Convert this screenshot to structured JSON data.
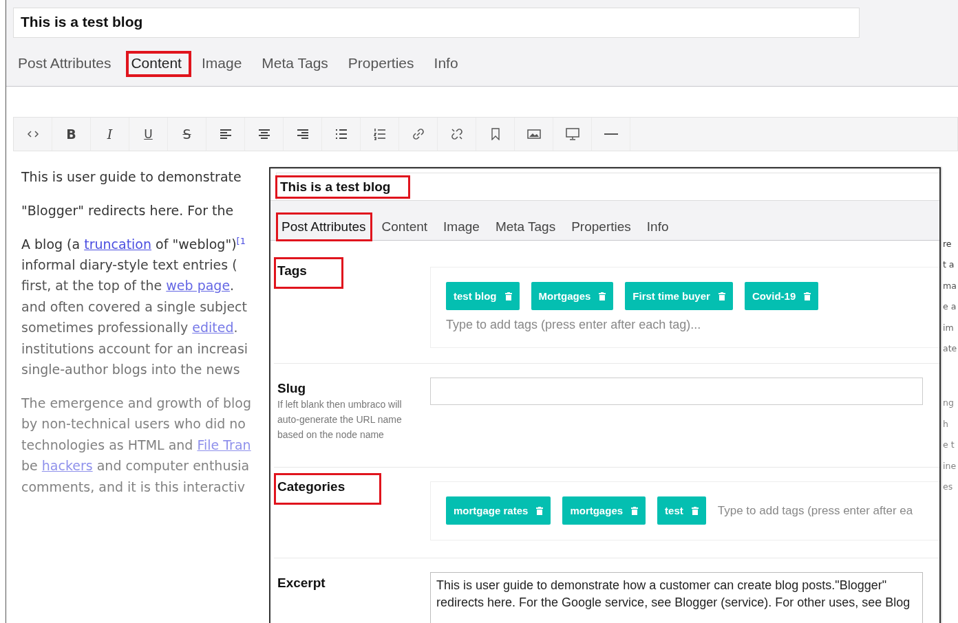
{
  "back_window": {
    "title": {
      "value": "This is a test blog",
      "highlighted": false
    },
    "tabs": [
      {
        "label": "Post Attributes",
        "highlighted": false
      },
      {
        "label": "Content",
        "highlighted": true
      },
      {
        "label": "Image",
        "highlighted": false
      },
      {
        "label": "Meta Tags",
        "highlighted": false
      },
      {
        "label": "Properties",
        "highlighted": false
      },
      {
        "label": "Info",
        "highlighted": false
      }
    ],
    "toolbar_letters": [
      "B",
      "I",
      "U",
      "S"
    ],
    "paragraphs": [
      [
        {
          "segments": [
            {
              "kind": "text",
              "text": "This is user guide to demonstrate"
            }
          ]
        }
      ],
      [
        {
          "segments": [
            {
              "kind": "text",
              "text": "\"Blogger\" redirects here. For the"
            }
          ]
        }
      ],
      [
        {
          "segments": [
            {
              "kind": "text",
              "text": "A blog (a "
            },
            {
              "kind": "link",
              "text": "truncation"
            },
            {
              "kind": "text",
              "text": " of \"weblog\")"
            },
            {
              "kind": "sup",
              "text": "[1"
            }
          ],
          "edge_fragment": "re"
        },
        {
          "segments": [
            {
              "kind": "text",
              "text": "informal diary-style text entries ("
            }
          ],
          "edge_fragment": "t a"
        },
        {
          "segments": [
            {
              "kind": "text",
              "text": "first, at the top of the "
            },
            {
              "kind": "link",
              "text": "web page"
            },
            {
              "kind": "text",
              "text": "."
            }
          ],
          "edge_fragment": "ma"
        },
        {
          "segments": [
            {
              "kind": "text",
              "text": "and often covered a single subject"
            }
          ],
          "edge_fragment": "e a"
        },
        {
          "segments": [
            {
              "kind": "text",
              "text": "sometimes professionally "
            },
            {
              "kind": "link",
              "text": "edited"
            },
            {
              "kind": "text",
              "text": "."
            }
          ],
          "edge_fragment": "im"
        },
        {
          "segments": [
            {
              "kind": "text",
              "text": "institutions account for an increasi"
            }
          ],
          "edge_fragment": "ate"
        },
        {
          "segments": [
            {
              "kind": "text",
              "text": "single-author blogs into the news"
            }
          ]
        }
      ],
      [
        {
          "segments": [
            {
              "kind": "text",
              "text": "The emergence and growth of blog"
            }
          ],
          "edge_fragment": "ng"
        },
        {
          "segments": [
            {
              "kind": "text",
              "text": "by non-technical users who did no"
            }
          ],
          "edge_fragment": "h"
        },
        {
          "segments": [
            {
              "kind": "text",
              "text": "technologies as HTML and "
            },
            {
              "kind": "link",
              "text": "File Tran"
            }
          ],
          "edge_fragment": "e t"
        },
        {
          "segments": [
            {
              "kind": "text",
              "text": "be "
            },
            {
              "kind": "link",
              "text": "hackers"
            },
            {
              "kind": "text",
              "text": " and computer enthusia"
            }
          ],
          "edge_fragment": "ine"
        },
        {
          "segments": [
            {
              "kind": "text",
              "text": "comments, and it is this interactiv"
            }
          ],
          "edge_fragment": "es"
        }
      ]
    ]
  },
  "front_window": {
    "title": {
      "value": "This is a test blog",
      "highlighted": true
    },
    "tabs": [
      {
        "label": "Post Attributes",
        "highlighted": true
      },
      {
        "label": "Content",
        "highlighted": false
      },
      {
        "label": "Image",
        "highlighted": false
      },
      {
        "label": "Meta Tags",
        "highlighted": false
      },
      {
        "label": "Properties",
        "highlighted": false
      },
      {
        "label": "Info",
        "highlighted": false
      }
    ],
    "fields": [
      {
        "kind": "tags",
        "label": "Tags",
        "highlighted": true,
        "tags": [
          "test blog",
          "Mortgages",
          "First time buyer",
          "Covid-19"
        ],
        "placeholder": "Type to add tags (press enter after each tag)..."
      },
      {
        "kind": "text",
        "label": "Slug",
        "highlighted": false,
        "description": "If left blank then umbraco will auto-generate the URL name based on the node name"
      },
      {
        "kind": "tags",
        "label": "Categories",
        "highlighted": true,
        "tags": [
          "mortgage rates",
          "mortgages",
          "test"
        ],
        "placeholder": "Type to add tags (press enter after ea"
      },
      {
        "kind": "textarea",
        "label": "Excerpt",
        "highlighted": false,
        "value": "This is user guide to demonstrate how a customer can create blog posts.\"Blogger\" redirects here. For the Google service, see Blogger (service). For other uses, see Blog"
      }
    ]
  }
}
